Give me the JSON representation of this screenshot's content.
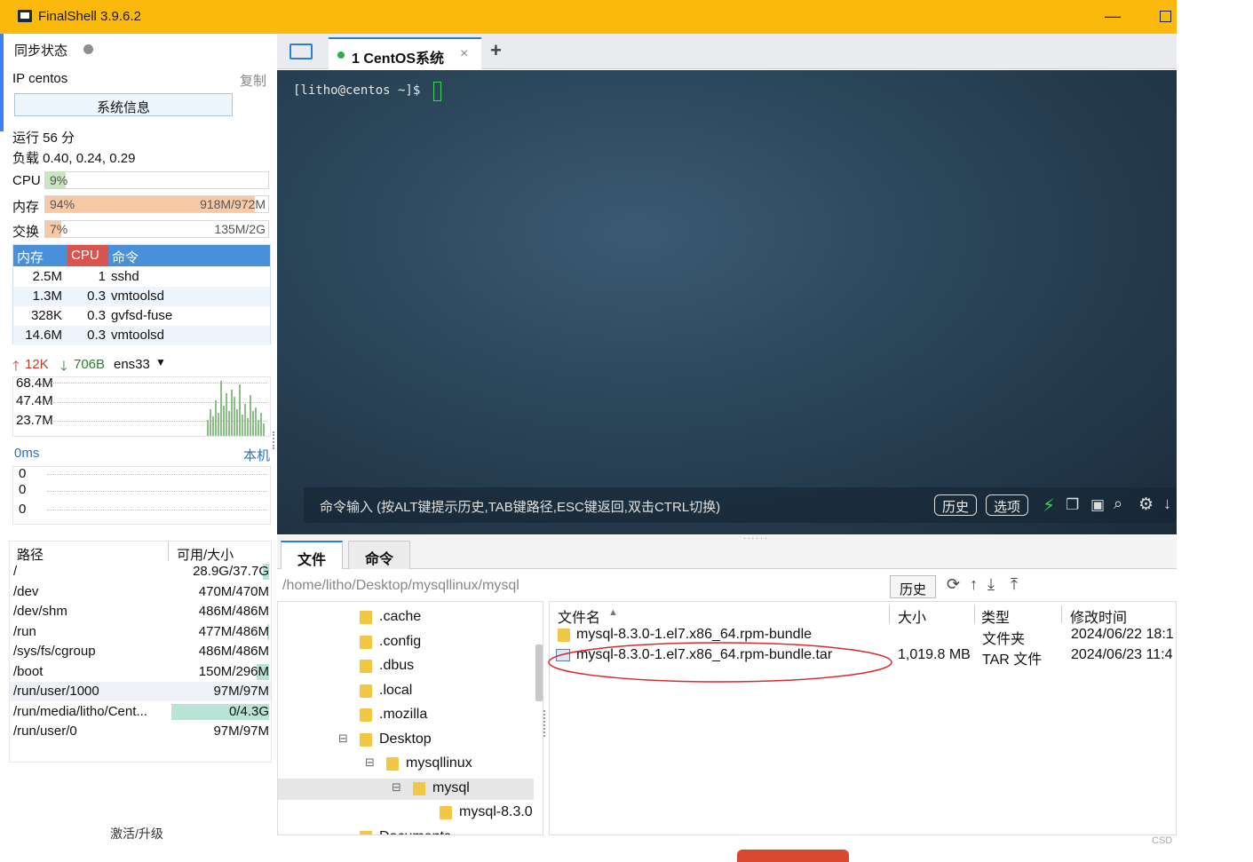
{
  "window": {
    "title": "FinalShell 3.9.6.2"
  },
  "sidebar": {
    "sync_label": "同步状态",
    "ip_label": "IP centos",
    "copy_label": "复制",
    "sysinfo_button": "系统信息",
    "uptime": "运行 56 分",
    "load": "负载 0.40, 0.24, 0.29",
    "cpu": {
      "label": "CPU",
      "percent_text": "9%",
      "percent": 9
    },
    "mem": {
      "label": "内存",
      "percent_text": "94%",
      "percent": 94,
      "usage": "918M/972M"
    },
    "swap": {
      "label": "交换",
      "percent_text": "7%",
      "percent": 7,
      "usage": "135M/2G"
    },
    "process_table": {
      "headers": [
        "内存",
        "CPU",
        "命令"
      ],
      "rows": [
        {
          "mem": "2.5M",
          "cpu": "1",
          "cmd": "sshd"
        },
        {
          "mem": "1.3M",
          "cpu": "0.3",
          "cmd": "vmtoolsd"
        },
        {
          "mem": "328K",
          "cpu": "0.3",
          "cmd": "gvfsd-fuse"
        },
        {
          "mem": "14.6M",
          "cpu": "0.3",
          "cmd": "vmtoolsd"
        }
      ]
    },
    "network": {
      "up": "12K",
      "down": "706B",
      "interface": "ens33",
      "scale": [
        "68.4M",
        "47.4M",
        "23.7M"
      ]
    },
    "ping": {
      "latency": "0ms",
      "host": "本机",
      "values": [
        "0",
        "0",
        "0"
      ]
    },
    "disk_table": {
      "headers": [
        "路径",
        "可用/大小"
      ],
      "rows": [
        {
          "path": "/",
          "size": "28.9G/37.7G",
          "used": 0.23
        },
        {
          "path": "/dev",
          "size": "470M/470M",
          "used": 0
        },
        {
          "path": "/dev/shm",
          "size": "486M/486M",
          "used": 0
        },
        {
          "path": "/run",
          "size": "477M/486M",
          "used": 0.02
        },
        {
          "path": "/sys/fs/cgroup",
          "size": "486M/486M",
          "used": 0
        },
        {
          "path": "/boot",
          "size": "150M/296M",
          "used": 0.49
        },
        {
          "path": "/run/user/1000",
          "size": "97M/97M",
          "used": 0
        },
        {
          "path": "/run/media/litho/Cent...",
          "size": "0/4.3G",
          "used": 1.0
        },
        {
          "path": "/run/user/0",
          "size": "97M/97M",
          "used": 0
        }
      ]
    },
    "activate_label": "激活/升级"
  },
  "session_tab": {
    "label": "1  CentOS系统",
    "close": "×",
    "add": "+"
  },
  "terminal": {
    "prompt": "[litho@centos ~]$ ",
    "command_hint": "命令输入 (按ALT键提示历史,TAB键路径,ESC键返回,双击CTRL切换)",
    "history_button": "历史",
    "options_button": "选项"
  },
  "file_panel": {
    "tabs": [
      "文件",
      "命令"
    ],
    "path": "/home/litho/Desktop/mysqllinux/mysql",
    "history_button": "历史",
    "tree": [
      {
        "name": ".cache",
        "depth": 1
      },
      {
        "name": ".config",
        "depth": 1
      },
      {
        "name": ".dbus",
        "depth": 1
      },
      {
        "name": ".local",
        "depth": 1
      },
      {
        "name": ".mozilla",
        "depth": 1
      },
      {
        "name": "Desktop",
        "depth": 1
      },
      {
        "name": "mysqllinux",
        "depth": 2
      },
      {
        "name": "mysql",
        "depth": 3
      },
      {
        "name": "mysql-8.3.0",
        "depth": 4
      },
      {
        "name": "Documents",
        "depth": 1
      }
    ],
    "columns": [
      "文件名",
      "大小",
      "类型",
      "修改时间"
    ],
    "files": [
      {
        "name": "mysql-8.3.0-1.el7.x86_64.rpm-bundle",
        "size": "",
        "type": "文件夹",
        "modified": "2024/06/22 18:1"
      },
      {
        "name": "mysql-8.3.0-1.el7.x86_64.rpm-bundle.tar",
        "size": "1,019.8 MB",
        "type": "TAR 文件",
        "modified": "2024/06/23 11:4"
      }
    ]
  },
  "colors": {
    "title_bar": "#fbb80d",
    "cpu_bar": "#c8e6c0",
    "mem_bar": "#f9c9a6",
    "table_header": "#4a90d9",
    "annotation_circle": "#d9292f"
  },
  "corner_watermark": "CSD"
}
